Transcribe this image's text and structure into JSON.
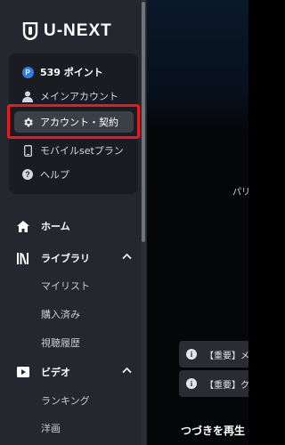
{
  "logo": {
    "text": "U-NEXT"
  },
  "account_menu": {
    "points": {
      "badge": "P",
      "label": "539 ポイント"
    },
    "items": [
      {
        "label": "メインアカウント",
        "icon": "user-icon"
      },
      {
        "label": "アカウント・契約",
        "icon": "gear-icon",
        "active": true
      },
      {
        "label": "モバイルsetプラン",
        "icon": "mobile-icon"
      },
      {
        "label": "ヘルプ",
        "icon": "help-icon"
      }
    ]
  },
  "nav": {
    "home": "ホーム",
    "library": {
      "label": "ライブラリ",
      "items": [
        "マイリスト",
        "購入済み",
        "視聴履歴"
      ]
    },
    "video": {
      "label": "ビデオ",
      "items": [
        "ランキング",
        "洋画"
      ]
    }
  },
  "main": {
    "partial_text": "パリ",
    "notices": [
      {
        "icon": "i",
        "text": "【重要】メー"
      },
      {
        "icon": "i",
        "text": "【重要】クレ"
      }
    ],
    "continue_title": "つづきを再生"
  },
  "colors": {
    "sidebar_bg": "#24272e",
    "panel_bg": "#1a1c21",
    "highlight": "#e31b23",
    "points_badge": "#2f7de1"
  }
}
